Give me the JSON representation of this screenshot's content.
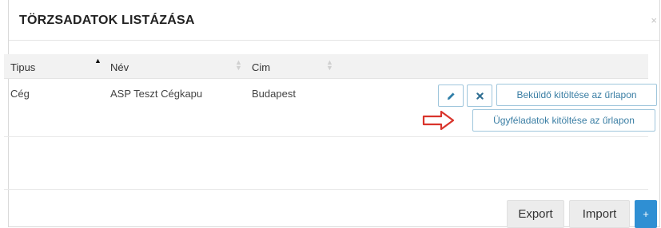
{
  "modal": {
    "title": "TÖRZSADATOK LISTÁZÁSA",
    "close_glyph": "×"
  },
  "table": {
    "columns": [
      {
        "label": "Tipus",
        "sort": "asc"
      },
      {
        "label": "Név",
        "sort": "none"
      },
      {
        "label": "Cim",
        "sort": "none"
      }
    ],
    "rows": [
      {
        "tipus": "Cég",
        "nev": "ASP Teszt Cégkapu",
        "cim": "Budapest",
        "actions": {
          "edit_icon": "pencil-icon",
          "delete_icon": "x-icon",
          "bekuldo_label": "Beküldő kitöltése az űrlapon",
          "ugyfel_label": "Ügyféladatok kitöltése az űrlapon"
        }
      }
    ]
  },
  "footer": {
    "export_label": "Export",
    "import_label": "Import",
    "add_glyph": "+"
  },
  "colors": {
    "accent_blue": "#2f8fd3",
    "button_border": "#9fc6dc",
    "arrow_red": "#d9342b"
  }
}
